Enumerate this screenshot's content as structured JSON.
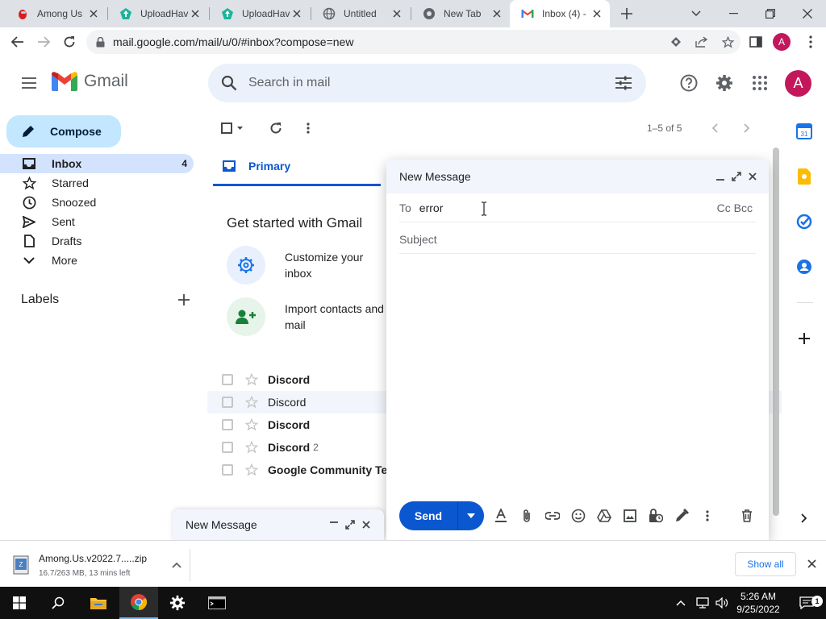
{
  "browser": {
    "tabs": [
      {
        "title": "Among Us",
        "icon": "among-us-favicon"
      },
      {
        "title": "UploadHaven",
        "icon": "uploadhaven-favicon"
      },
      {
        "title": "UploadHaven",
        "icon": "uploadhaven-favicon"
      },
      {
        "title": "Untitled",
        "icon": "globe-favicon"
      },
      {
        "title": "New Tab",
        "icon": "chrome-favicon"
      },
      {
        "title": "Inbox (4) -",
        "icon": "gmail-favicon",
        "active": true
      }
    ],
    "url": "mail.google.com/mail/u/0/#inbox?compose=new",
    "profile_initial": "A"
  },
  "gmail": {
    "app_name": "Gmail",
    "search_placeholder": "Search in mail",
    "avatar_initial": "A",
    "compose_label": "Compose",
    "nav": [
      {
        "label": "Inbox",
        "count": "4",
        "icon": "inbox-icon",
        "active": true
      },
      {
        "label": "Starred",
        "count": "",
        "icon": "star-icon"
      },
      {
        "label": "Snoozed",
        "count": "",
        "icon": "clock-icon"
      },
      {
        "label": "Sent",
        "count": "",
        "icon": "send-icon"
      },
      {
        "label": "Drafts",
        "count": "",
        "icon": "draft-icon"
      },
      {
        "label": "More",
        "count": "",
        "icon": "chevron-down-icon"
      }
    ],
    "labels_heading": "Labels",
    "pager": "1–5 of 5",
    "primary_tab": "Primary",
    "getting_started": {
      "heading": "Get started with Gmail",
      "tips": [
        {
          "label": "Customize your inbox",
          "icon": "settings-gear-icon"
        },
        {
          "label": "Import contacts and mail",
          "icon": "add-contacts-icon"
        }
      ]
    },
    "emails": [
      {
        "sender": "Discord",
        "count": "",
        "unread": true
      },
      {
        "sender": "Discord",
        "count": "",
        "unread": false
      },
      {
        "sender": "Discord",
        "count": "",
        "unread": true
      },
      {
        "sender": "Discord",
        "count": "2",
        "unread": true
      },
      {
        "sender": "Google Community Te",
        "count": "",
        "unread": true
      }
    ]
  },
  "compose_window": {
    "title": "New Message",
    "to_label": "To",
    "to_value": "error",
    "cc_bcc": "Cc Bcc",
    "subject_placeholder": "Subject",
    "send_label": "Send"
  },
  "mini_compose": {
    "title": "New Message"
  },
  "downloads": {
    "file_name": "Among.Us.v2022.7.....zip",
    "status": "16.7/263 MB, 13 mins left",
    "show_all": "Show all"
  },
  "taskbar": {
    "time": "5:26 AM",
    "date": "9/25/2022"
  },
  "colors": {
    "accent": "#0b57d0",
    "compose_bg": "#c2e7ff",
    "avatar": "#c2185b"
  }
}
